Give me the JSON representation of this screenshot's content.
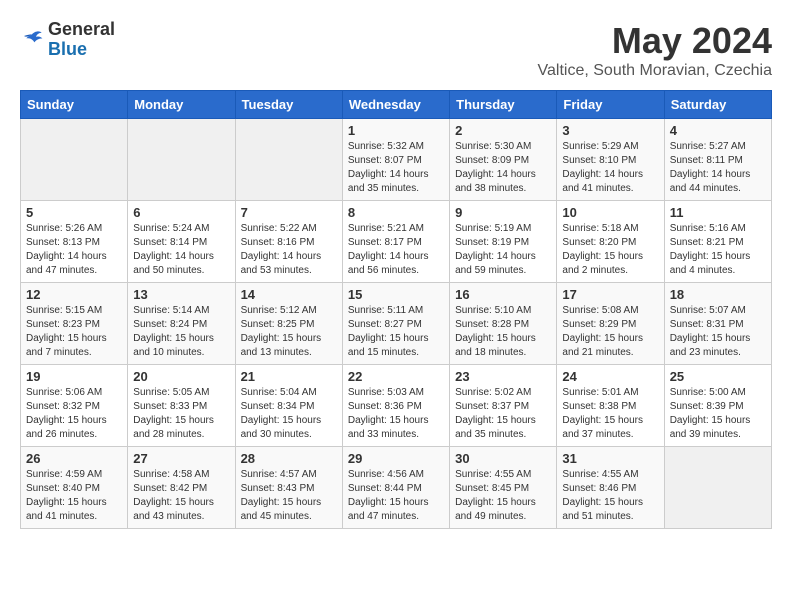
{
  "header": {
    "logo_general": "General",
    "logo_blue": "Blue",
    "month_year": "May 2024",
    "location": "Valtice, South Moravian, Czechia"
  },
  "weekdays": [
    "Sunday",
    "Monday",
    "Tuesday",
    "Wednesday",
    "Thursday",
    "Friday",
    "Saturday"
  ],
  "weeks": [
    [
      {
        "day": "",
        "info": ""
      },
      {
        "day": "",
        "info": ""
      },
      {
        "day": "",
        "info": ""
      },
      {
        "day": "1",
        "info": "Sunrise: 5:32 AM\nSunset: 8:07 PM\nDaylight: 14 hours\nand 35 minutes."
      },
      {
        "day": "2",
        "info": "Sunrise: 5:30 AM\nSunset: 8:09 PM\nDaylight: 14 hours\nand 38 minutes."
      },
      {
        "day": "3",
        "info": "Sunrise: 5:29 AM\nSunset: 8:10 PM\nDaylight: 14 hours\nand 41 minutes."
      },
      {
        "day": "4",
        "info": "Sunrise: 5:27 AM\nSunset: 8:11 PM\nDaylight: 14 hours\nand 44 minutes."
      }
    ],
    [
      {
        "day": "5",
        "info": "Sunrise: 5:26 AM\nSunset: 8:13 PM\nDaylight: 14 hours\nand 47 minutes."
      },
      {
        "day": "6",
        "info": "Sunrise: 5:24 AM\nSunset: 8:14 PM\nDaylight: 14 hours\nand 50 minutes."
      },
      {
        "day": "7",
        "info": "Sunrise: 5:22 AM\nSunset: 8:16 PM\nDaylight: 14 hours\nand 53 minutes."
      },
      {
        "day": "8",
        "info": "Sunrise: 5:21 AM\nSunset: 8:17 PM\nDaylight: 14 hours\nand 56 minutes."
      },
      {
        "day": "9",
        "info": "Sunrise: 5:19 AM\nSunset: 8:19 PM\nDaylight: 14 hours\nand 59 minutes."
      },
      {
        "day": "10",
        "info": "Sunrise: 5:18 AM\nSunset: 8:20 PM\nDaylight: 15 hours\nand 2 minutes."
      },
      {
        "day": "11",
        "info": "Sunrise: 5:16 AM\nSunset: 8:21 PM\nDaylight: 15 hours\nand 4 minutes."
      }
    ],
    [
      {
        "day": "12",
        "info": "Sunrise: 5:15 AM\nSunset: 8:23 PM\nDaylight: 15 hours\nand 7 minutes."
      },
      {
        "day": "13",
        "info": "Sunrise: 5:14 AM\nSunset: 8:24 PM\nDaylight: 15 hours\nand 10 minutes."
      },
      {
        "day": "14",
        "info": "Sunrise: 5:12 AM\nSunset: 8:25 PM\nDaylight: 15 hours\nand 13 minutes."
      },
      {
        "day": "15",
        "info": "Sunrise: 5:11 AM\nSunset: 8:27 PM\nDaylight: 15 hours\nand 15 minutes."
      },
      {
        "day": "16",
        "info": "Sunrise: 5:10 AM\nSunset: 8:28 PM\nDaylight: 15 hours\nand 18 minutes."
      },
      {
        "day": "17",
        "info": "Sunrise: 5:08 AM\nSunset: 8:29 PM\nDaylight: 15 hours\nand 21 minutes."
      },
      {
        "day": "18",
        "info": "Sunrise: 5:07 AM\nSunset: 8:31 PM\nDaylight: 15 hours\nand 23 minutes."
      }
    ],
    [
      {
        "day": "19",
        "info": "Sunrise: 5:06 AM\nSunset: 8:32 PM\nDaylight: 15 hours\nand 26 minutes."
      },
      {
        "day": "20",
        "info": "Sunrise: 5:05 AM\nSunset: 8:33 PM\nDaylight: 15 hours\nand 28 minutes."
      },
      {
        "day": "21",
        "info": "Sunrise: 5:04 AM\nSunset: 8:34 PM\nDaylight: 15 hours\nand 30 minutes."
      },
      {
        "day": "22",
        "info": "Sunrise: 5:03 AM\nSunset: 8:36 PM\nDaylight: 15 hours\nand 33 minutes."
      },
      {
        "day": "23",
        "info": "Sunrise: 5:02 AM\nSunset: 8:37 PM\nDaylight: 15 hours\nand 35 minutes."
      },
      {
        "day": "24",
        "info": "Sunrise: 5:01 AM\nSunset: 8:38 PM\nDaylight: 15 hours\nand 37 minutes."
      },
      {
        "day": "25",
        "info": "Sunrise: 5:00 AM\nSunset: 8:39 PM\nDaylight: 15 hours\nand 39 minutes."
      }
    ],
    [
      {
        "day": "26",
        "info": "Sunrise: 4:59 AM\nSunset: 8:40 PM\nDaylight: 15 hours\nand 41 minutes."
      },
      {
        "day": "27",
        "info": "Sunrise: 4:58 AM\nSunset: 8:42 PM\nDaylight: 15 hours\nand 43 minutes."
      },
      {
        "day": "28",
        "info": "Sunrise: 4:57 AM\nSunset: 8:43 PM\nDaylight: 15 hours\nand 45 minutes."
      },
      {
        "day": "29",
        "info": "Sunrise: 4:56 AM\nSunset: 8:44 PM\nDaylight: 15 hours\nand 47 minutes."
      },
      {
        "day": "30",
        "info": "Sunrise: 4:55 AM\nSunset: 8:45 PM\nDaylight: 15 hours\nand 49 minutes."
      },
      {
        "day": "31",
        "info": "Sunrise: 4:55 AM\nSunset: 8:46 PM\nDaylight: 15 hours\nand 51 minutes."
      },
      {
        "day": "",
        "info": ""
      }
    ]
  ]
}
